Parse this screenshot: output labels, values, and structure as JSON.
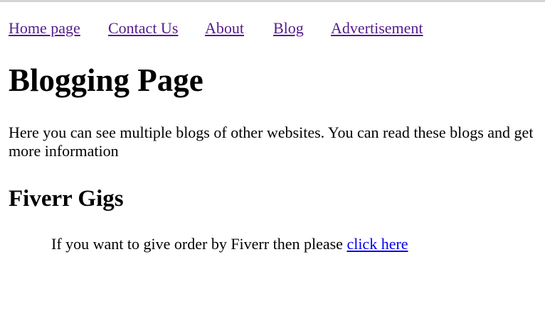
{
  "nav": {
    "items": [
      {
        "label": "Home page"
      },
      {
        "label": "Contact Us"
      },
      {
        "label": "About"
      },
      {
        "label": "Blog"
      },
      {
        "label": "Advertisement"
      }
    ],
    "visited_color": "#551a8b"
  },
  "page": {
    "title": "Blogging Page",
    "intro": "Here you can see multiple blogs of other websites. You can read these blogs and get more information"
  },
  "fiverr": {
    "heading": "Fiverr Gigs",
    "text": "If you want to give order by Fiverr then please ",
    "link_label": "click here",
    "link_color": "#0000ee"
  }
}
